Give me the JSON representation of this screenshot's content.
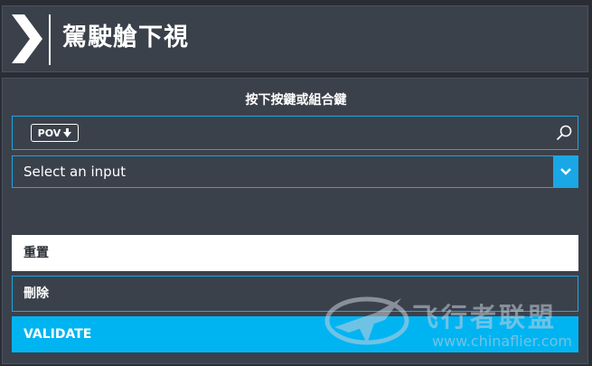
{
  "header": {
    "title": "駕駛艙下視"
  },
  "dialog": {
    "prompt": "按下按鍵或組合鍵",
    "search": {
      "badge_label": "POV"
    },
    "input_select": {
      "selected": "Select an input"
    },
    "buttons": {
      "reset": "重置",
      "delete": "刪除",
      "validate": "VALIDATE"
    }
  },
  "watermark": {
    "name": "飞行者联盟",
    "url": "www.chinaflier.com"
  },
  "colors": {
    "accent": "#1aa7e6",
    "validate": "#00b4f2",
    "panel": "#3b414b",
    "background": "#2a2e34"
  },
  "icons": {
    "header": "chevron-right-icon",
    "badge": "arrow-down-icon",
    "search": "search-icon",
    "dropdown": "chevron-down-icon",
    "watermark": "plane-logo-icon"
  }
}
